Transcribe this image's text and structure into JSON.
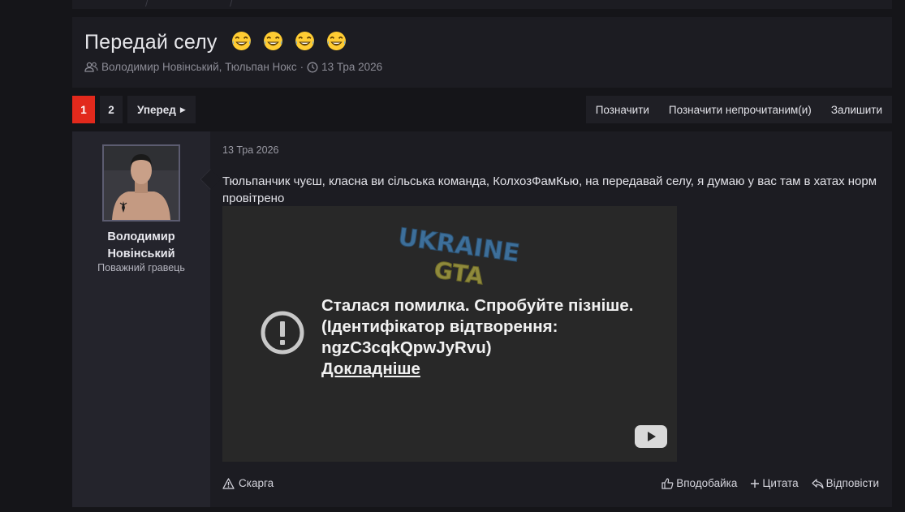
{
  "thread": {
    "title": "Передай селу",
    "emoji_name": "joy-emoji",
    "participants": "Володимир Новінський, Тюльпан Нокс",
    "separator": "·",
    "date": "13 Тра 2026"
  },
  "pagination": {
    "pages": [
      "1",
      "2"
    ],
    "current": "1",
    "next_label": "Уперед"
  },
  "thread_actions": [
    "Позначити",
    "Позначити непрочитаним(и)",
    "Залишити"
  ],
  "post": {
    "author": {
      "name": "Володимир Новінський",
      "title": "Поважний гравець",
      "avatar": "avatar-image"
    },
    "date": "13 Тра 2026",
    "text": "Тюльпанчик чуєш, класна ви сільська команда, КолхозФамКью, на передавай селу, я думаю у вас там в хатах норм провітрено",
    "embed": {
      "logo_text_top": "UKRAINE",
      "logo_text_bottom": "GTA",
      "error_line1": "Сталася помилка. Спробуйте пізніше.",
      "error_line2": "(Ідентифікатор відтворення:",
      "error_line3": "ngzC3cqkQpwJyRvu)",
      "error_link": "Докладніше",
      "icon": "error-icon",
      "play_icon": "youtube-icon"
    },
    "report_label": "Скарга",
    "actions": [
      {
        "label": "Вподобайка",
        "icon": "thumbs-up-icon"
      },
      {
        "label": "Цитата",
        "icon": "plus-icon"
      },
      {
        "label": "Відповісти",
        "icon": "reply-icon"
      }
    ]
  },
  "colors": {
    "background": "#151519",
    "panel": "#1c1c22",
    "user_panel": "#24242c",
    "accent": "#e2291c"
  }
}
